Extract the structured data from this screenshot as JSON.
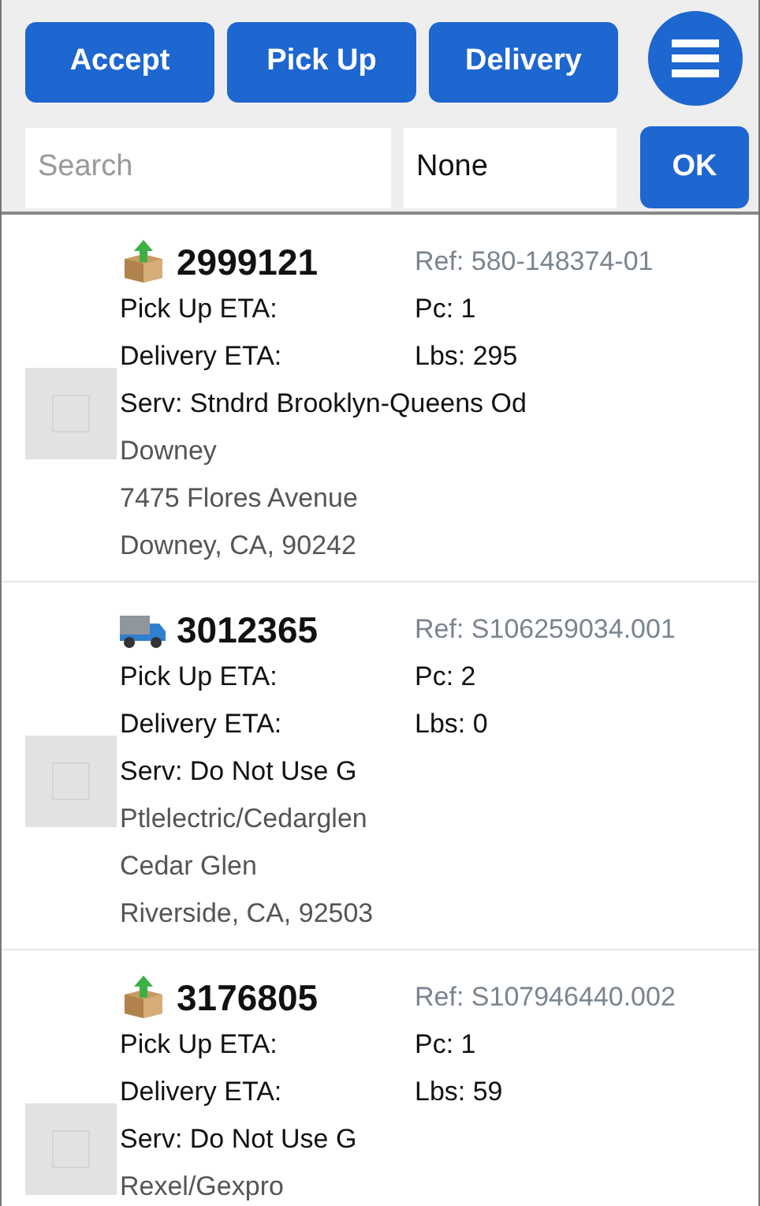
{
  "actions": [
    {
      "label": "Accept"
    },
    {
      "label": "Pick Up"
    },
    {
      "label": "Delivery"
    }
  ],
  "search": {
    "placeholder": "Search"
  },
  "filter": {
    "value": "None"
  },
  "ok_button": "OK",
  "orders": [
    {
      "kind": "pickup",
      "number": "2999121",
      "ref": "Ref: 580-148374-01",
      "checked": false,
      "pickup_eta": "Pick Up ETA:",
      "pieces": "Pc: 1",
      "delivery_eta": "Delivery ETA:",
      "weight": "Lbs: 295",
      "service": "Serv: Stndrd Brooklyn-Queens Od",
      "address": [
        "Downey",
        "7475 Flores Avenue",
        "Downey, CA, 90242"
      ]
    },
    {
      "kind": "delivery",
      "number": "3012365",
      "ref": "Ref: S106259034.001",
      "checked": false,
      "pickup_eta": "Pick Up ETA:",
      "pieces": "Pc: 2",
      "delivery_eta": "Delivery ETA:",
      "weight": "Lbs: 0",
      "service": "Serv: Do Not Use G",
      "address": [
        "Ptlelectric/Cedarglen",
        "Cedar Glen",
        "Riverside, CA, 92503"
      ]
    },
    {
      "kind": "pickup",
      "number": "3176805",
      "ref": "Ref: S107946440.002",
      "checked": false,
      "pickup_eta": "Pick Up ETA:",
      "pieces": "Pc: 1",
      "delivery_eta": "Delivery ETA:",
      "weight": "Lbs: 59",
      "service": "Serv: Do Not Use G",
      "address": [
        "Rexel/Gexpro"
      ]
    }
  ]
}
